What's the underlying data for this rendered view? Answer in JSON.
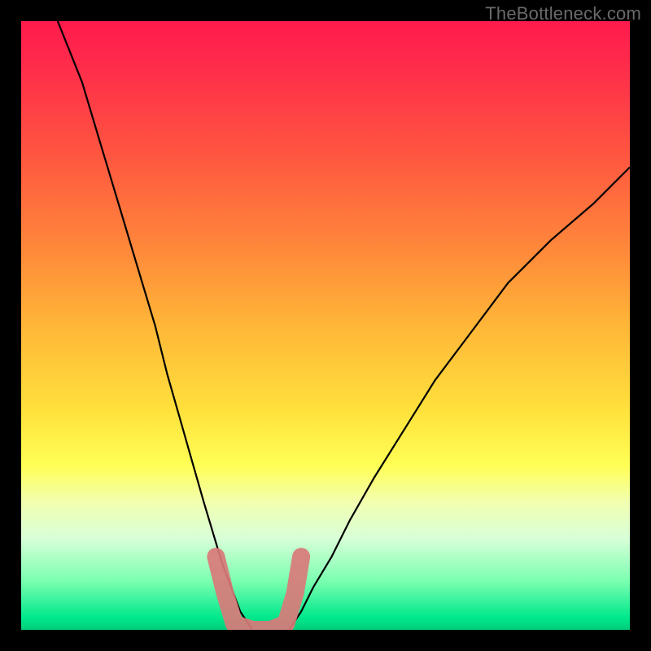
{
  "watermark": {
    "text": "TheBottleneck.com"
  },
  "colors": {
    "gradient_top": "#ff1a4d",
    "gradient_mid": "#ffe13c",
    "gradient_bottom": "#00cc7a",
    "curve": "#000000",
    "overlay_marker": "#d97a7a",
    "frame": "#000000"
  },
  "chart_data": {
    "type": "line",
    "title": "",
    "xlabel": "",
    "ylabel": "",
    "xlim": [
      0,
      100
    ],
    "ylim": [
      0,
      100
    ],
    "grid": false,
    "legend": false,
    "series": [
      {
        "name": "left_curve",
        "x": [
          6,
          10,
          13,
          16,
          19,
          22,
          24,
          26,
          28,
          30,
          31.5,
          33,
          34.5,
          36,
          38
        ],
        "values": [
          100,
          90,
          80,
          70,
          60,
          50,
          42,
          35,
          28,
          21,
          16,
          11,
          7,
          3,
          0
        ]
      },
      {
        "name": "right_curve",
        "x": [
          44,
          46,
          48,
          51,
          54,
          58,
          63,
          68,
          74,
          80,
          87,
          94,
          100
        ],
        "values": [
          0,
          3,
          7,
          12,
          18,
          25,
          33,
          41,
          49,
          57,
          64,
          70,
          76
        ]
      },
      {
        "name": "optimum_marker",
        "x": [
          32,
          33.5,
          35,
          38,
          41,
          43.5,
          45,
          46
        ],
        "values": [
          12,
          6,
          1,
          0,
          0,
          1,
          6,
          12
        ]
      }
    ],
    "annotations": []
  }
}
